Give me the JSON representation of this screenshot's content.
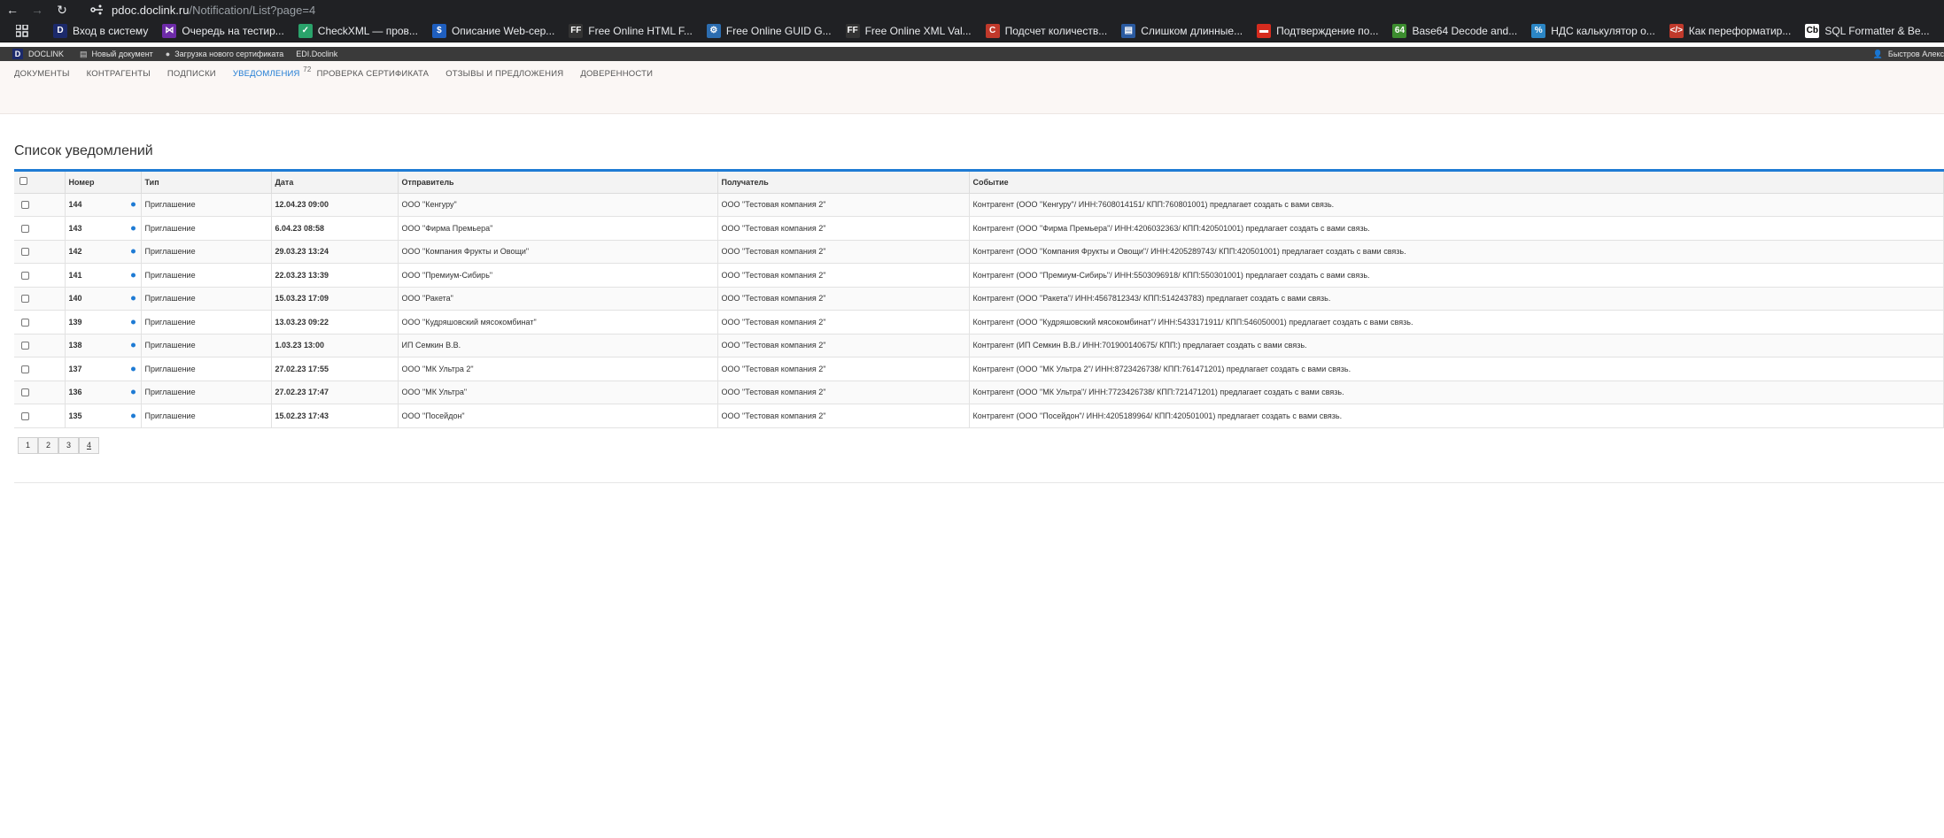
{
  "browser": {
    "url_host": "pdoc.doclink.ru",
    "url_path": "/Notification/List?page=4"
  },
  "bookmarks": [
    {
      "label": "Вход в систему",
      "icon": "doclink-icon",
      "color": "#1c2a6b",
      "glyph": "D"
    },
    {
      "label": "Очередь на тестир...",
      "icon": "visual-studio-icon",
      "color": "#6d2ba8",
      "glyph": "⋈"
    },
    {
      "label": "CheckXML — пров...",
      "icon": "checkxml-icon",
      "color": "#2aa36b",
      "glyph": "✓"
    },
    {
      "label": "Описание Web-сер...",
      "icon": "web-service-icon",
      "color": "#1f5fbf",
      "glyph": "$"
    },
    {
      "label": "Free Online HTML F...",
      "icon": "freeformatter-icon",
      "color": "#333333",
      "glyph": "FF"
    },
    {
      "label": "Free Online GUID G...",
      "icon": "guid-icon",
      "color": "#2c6db0",
      "glyph": "⚙"
    },
    {
      "label": "Free Online XML Val...",
      "icon": "freeformatter-icon",
      "color": "#333333",
      "glyph": "FF"
    },
    {
      "label": "Подсчет количеств...",
      "icon": "counter-icon",
      "color": "#c0392b",
      "glyph": "C"
    },
    {
      "label": "Слишком длинные...",
      "icon": "document-icon",
      "color": "#2a5aa0",
      "glyph": "▤"
    },
    {
      "label": "Подтверждение по...",
      "icon": "flag-icon",
      "color": "#d52b1e",
      "glyph": "▬"
    },
    {
      "label": "Base64 Decode and...",
      "icon": "base64-icon",
      "color": "#3c8d2f",
      "glyph": "64"
    },
    {
      "label": "НДС калькулятор о...",
      "icon": "calculator-icon",
      "color": "#2b86c5",
      "glyph": "%"
    },
    {
      "label": "Как переформатир...",
      "icon": "code-icon",
      "color": "#c0392b",
      "glyph": "</>"
    },
    {
      "label": "SQL Formatter & Be...",
      "icon": "sql-icon",
      "color": "#ffffff",
      "glyph": "Cb"
    }
  ],
  "app_header": {
    "logo": "DOCLINK",
    "new_doc": "Новый документ",
    "upload_cert": "Загрузка нового сертификата",
    "edi": "EDI.Doclink",
    "user": "Быстров Алекс"
  },
  "tabs": [
    {
      "label": "ДОКУМЕНТЫ",
      "active": false
    },
    {
      "label": "КОНТРАГЕНТЫ",
      "active": false
    },
    {
      "label": "ПОДПИСКИ",
      "active": false
    },
    {
      "label": "УВЕДОМЛЕНИЯ",
      "active": true,
      "badge": "72"
    },
    {
      "label": "ПРОВЕРКА СЕРТИФИКАТА",
      "active": false
    },
    {
      "label": "ОТЗЫВЫ И ПРЕДЛОЖЕНИЯ",
      "active": false
    },
    {
      "label": "ДОВЕРЕННОСТИ",
      "active": false
    }
  ],
  "page_title": "Список уведомлений",
  "table": {
    "columns": [
      "Номер",
      "Тип",
      "Дата",
      "Отправитель",
      "Получатель",
      "Событие"
    ],
    "rows": [
      {
        "num": "144",
        "type": "Приглашение",
        "date": "12.04.23 09:00",
        "sender": "ООО \"Кенгуру\"",
        "recipient": "ООО \"Тестовая компания 2\"",
        "event": "Контрагент (ООО \"Кенгуру\"/ ИНН:7608014151/ КПП:760801001) предлагает создать с вами связь."
      },
      {
        "num": "143",
        "type": "Приглашение",
        "date": "6.04.23 08:58",
        "sender": "ООО \"Фирма Премьера\"",
        "recipient": "ООО \"Тестовая компания 2\"",
        "event": "Контрагент (ООО \"Фирма Премьера\"/ ИНН:4206032363/ КПП:420501001) предлагает создать с вами связь."
      },
      {
        "num": "142",
        "type": "Приглашение",
        "date": "29.03.23 13:24",
        "sender": "ООО \"Компания Фрукты и Овощи\"",
        "recipient": "ООО \"Тестовая компания 2\"",
        "event": "Контрагент (ООО \"Компания Фрукты и Овощи\"/ ИНН:4205289743/ КПП:420501001) предлагает создать с вами связь."
      },
      {
        "num": "141",
        "type": "Приглашение",
        "date": "22.03.23 13:39",
        "sender": "ООО \"Премиум-Сибирь\"",
        "recipient": "ООО \"Тестовая компания 2\"",
        "event": "Контрагент (ООО \"Премиум-Сибирь\"/ ИНН:5503096918/ КПП:550301001) предлагает создать с вами связь."
      },
      {
        "num": "140",
        "type": "Приглашение",
        "date": "15.03.23 17:09",
        "sender": "ООО \"Ракета\"",
        "recipient": "ООО \"Тестовая компания 2\"",
        "event": "Контрагент (ООО \"Ракета\"/ ИНН:4567812343/ КПП:514243783) предлагает создать с вами связь."
      },
      {
        "num": "139",
        "type": "Приглашение",
        "date": "13.03.23 09:22",
        "sender": "ООО \"Кудряшовский мясокомбинат\"",
        "recipient": "ООО \"Тестовая компания 2\"",
        "event": "Контрагент (ООО \"Кудряшовский мясокомбинат\"/ ИНН:5433171911/ КПП:546050001) предлагает создать с вами связь."
      },
      {
        "num": "138",
        "type": "Приглашение",
        "date": "1.03.23 13:00",
        "sender": "ИП Семкин В.В.",
        "recipient": "ООО \"Тестовая компания 2\"",
        "event": "Контрагент (ИП Семкин В.В./ ИНН:701900140675/ КПП:) предлагает создать с вами связь."
      },
      {
        "num": "137",
        "type": "Приглашение",
        "date": "27.02.23 17:55",
        "sender": "ООО \"МК Ультра 2\"",
        "recipient": "ООО \"Тестовая компания 2\"",
        "event": "Контрагент (ООО \"МК Ультра 2\"/ ИНН:8723426738/ КПП:761471201) предлагает создать с вами связь."
      },
      {
        "num": "136",
        "type": "Приглашение",
        "date": "27.02.23 17:47",
        "sender": "ООО \"МК Ультра\"",
        "recipient": "ООО \"Тестовая компания 2\"",
        "event": "Контрагент (ООО \"МК Ультра\"/ ИНН:7723426738/ КПП:721471201) предлагает создать с вами связь."
      },
      {
        "num": "135",
        "type": "Приглашение",
        "date": "15.02.23 17:43",
        "sender": "ООО \"Посейдон\"",
        "recipient": "ООО \"Тестовая компания 2\"",
        "event": "Контрагент (ООО \"Посейдон\"/ ИНН:4205189964/ КПП:420501001) предлагает создать с вами связь."
      }
    ]
  },
  "pagination": {
    "pages": [
      "1",
      "2",
      "3",
      "4"
    ],
    "current": "4"
  },
  "colors": {
    "accent": "#1e7bd4",
    "browser_bg": "#202124",
    "app_header_bg": "#3a3a3a"
  }
}
